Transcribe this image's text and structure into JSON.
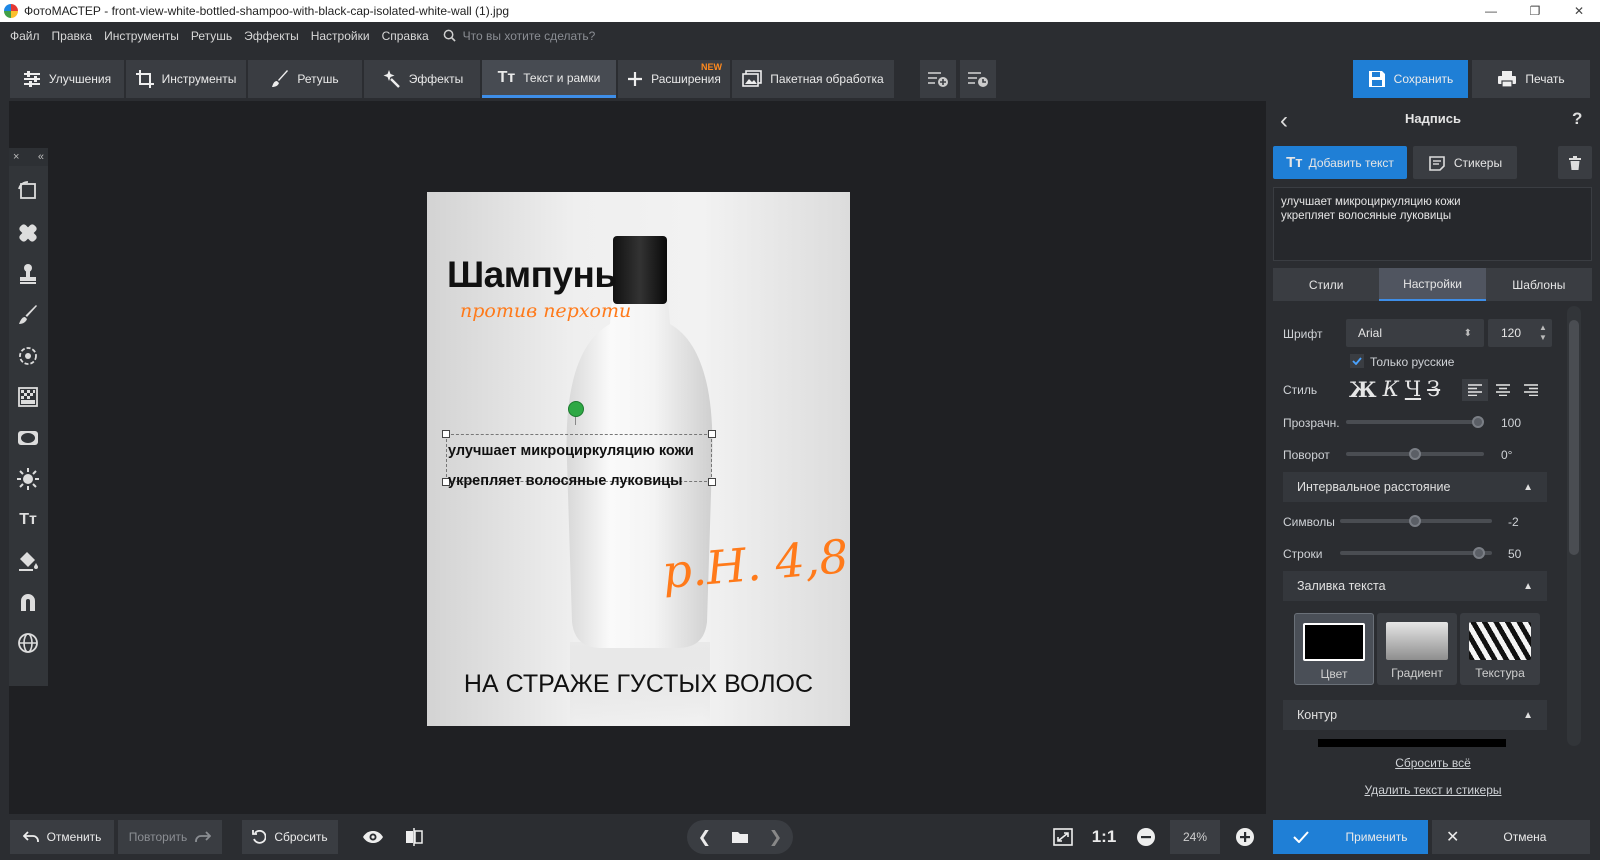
{
  "window": {
    "title": "ФотоМАСТЕР - front-view-white-bottled-shampoo-with-black-cap-isolated-white-wall (1).jpg",
    "minimize": "—",
    "restore": "❐",
    "close": "✕"
  },
  "menu": {
    "items": [
      "Файл",
      "Правка",
      "Инструменты",
      "Ретушь",
      "Эффекты",
      "Настройки",
      "Справка"
    ],
    "search_placeholder": "Что вы хотите сделать?"
  },
  "toolbar": {
    "tabs": [
      {
        "label": "Улучшения",
        "icon": "sliders-icon"
      },
      {
        "label": "Инструменты",
        "icon": "crop-icon"
      },
      {
        "label": "Ретушь",
        "icon": "brush-icon"
      },
      {
        "label": "Эффекты",
        "icon": "magic-wand-icon"
      },
      {
        "label": "Текст и рамки",
        "icon": "text-icon"
      },
      {
        "label": "Расширения",
        "icon": "plus-icon",
        "badge": "NEW"
      },
      {
        "label": "Пакетная обработка",
        "icon": "batch-icon"
      }
    ],
    "active_tab": "Текст и рамки",
    "save_label": "Сохранить",
    "print_label": "Печать"
  },
  "left_tools": {
    "close": "×",
    "collapse": "«",
    "icons": [
      "rotate-icon",
      "healing-icon",
      "stamp-icon",
      "brush-icon",
      "radial-icon",
      "gradient-filter-icon",
      "vignette-icon",
      "light-icon",
      "text-tool-icon",
      "fill-bucket-icon",
      "magnet-icon",
      "globe-icon"
    ]
  },
  "photo": {
    "title": "Шампунь",
    "subtitle": "против перхоти",
    "selected_line1": "улучшает микроциркуляцию кожи",
    "selected_line2": "укрепляет волосяные луковицы",
    "ph": "p.H. 4,8",
    "bottom_text": "НА СТРАЖЕ ГУСТЫХ ВОЛОС"
  },
  "panel": {
    "title": "Надпись",
    "back": "‹",
    "help": "?",
    "add_text": "Добавить текст",
    "stickers": "Стикеры",
    "text_line1": "улучшает микроциркуляцию кожи",
    "text_line2": "укрепляет волосяные луковицы",
    "tabs": [
      "Стили",
      "Настройки",
      "Шаблоны"
    ],
    "active_tab": "Настройки",
    "font_label": "Шрифт",
    "font_value": "Arial",
    "font_size": "120",
    "only_russian": "Только русские",
    "style_label": "Стиль",
    "style_buttons": [
      "Ж",
      "К",
      "Ч",
      "З"
    ],
    "opacity_label": "Прозрачн.",
    "opacity_value": "100",
    "opacity_level": 1.0,
    "rotation_label": "Поворот",
    "rotation_value": "0°",
    "rotation_level": 0.5,
    "spacing_section": "Интервальное расстояние",
    "chars_label": "Символы",
    "chars_value": "-2",
    "chars_level": 0.49,
    "lines_label": "Строки",
    "lines_value": "50",
    "lines_level": 0.95,
    "fill_section": "Заливка текста",
    "fill_options": [
      "Цвет",
      "Градиент",
      "Текстура"
    ],
    "fill_selected": "Цвет",
    "outline_section": "Контур",
    "reset_all": "Сбросить всё",
    "delete_all": "Удалить текст и стикеры",
    "apply": "Применить",
    "cancel": "Отмена"
  },
  "bottombar": {
    "undo": "Отменить",
    "redo": "Повторить",
    "reset": "Сбросить",
    "zoom_fit": "1:1",
    "zoom_value": "24%"
  },
  "colors": {
    "accent": "#1f7fd6",
    "active_tab_border": "#3e8ee8",
    "orange": "#ff7a1a",
    "badge": "#ff8a1e"
  }
}
